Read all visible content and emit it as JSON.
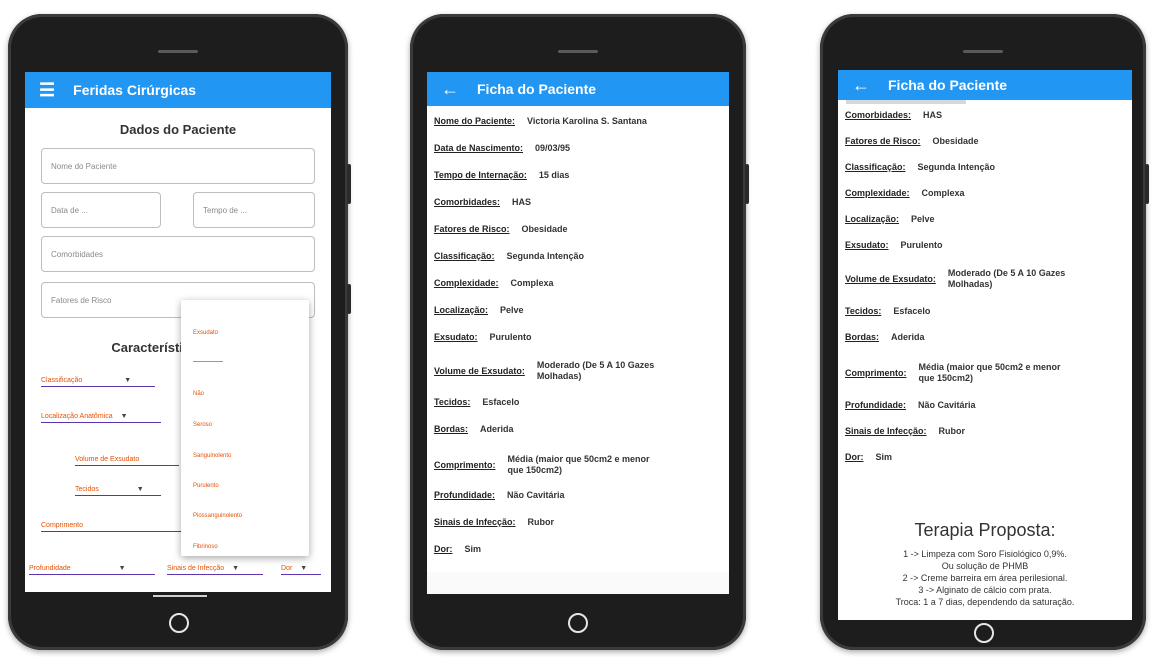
{
  "phone1": {
    "appbar": {
      "menu_icon": "hamburger-icon",
      "title": "Feridas Cirúrgicas"
    },
    "section_title": "Dados do Paciente",
    "fields": {
      "nome": "Nome do Paciente",
      "data": "Data de ...",
      "tempo": "Tempo de ...",
      "comorbidades": "Comorbidades",
      "fatores": "Fatores de Risco"
    },
    "characteristics_title": "Características",
    "selects": {
      "classificacao": "Classificação",
      "localizacao": "Localização Anatômica",
      "volume": "Volume de Exsudato",
      "tecidos": "Tecidos",
      "comprimento": "Comprimento",
      "profundidade": "Profundidade",
      "sinais": "Sinais de Infecção",
      "dor": "Dor"
    },
    "dropdown": {
      "header": "Exsudato",
      "options": [
        "Não",
        "Seroso",
        "Sanguinolento",
        "Purulento",
        "Piossanguinolento",
        "Fibrinoso"
      ]
    }
  },
  "phone2": {
    "appbar": {
      "back_icon": "arrow-left-icon",
      "title": "Ficha do Paciente"
    },
    "rows": [
      {
        "label": "Nome do Paciente:",
        "value": "Victoria Karolina S. Santana"
      },
      {
        "label": "Data de Nascimento:",
        "value": "09/03/95"
      },
      {
        "label": "Tempo de Internação:",
        "value": "15 dias"
      },
      {
        "label": "Comorbidades:",
        "value": "HAS"
      },
      {
        "label": "Fatores de Risco:",
        "value": "Obesidade"
      },
      {
        "label": "Classificação:",
        "value": "Segunda Intenção"
      },
      {
        "label": "Complexidade:",
        "value": "Complexa"
      },
      {
        "label": "Localização:",
        "value": "Pelve"
      },
      {
        "label": "Exsudato:",
        "value": "Purulento"
      },
      {
        "label": "Volume de Exsudato:",
        "value": "Moderado (De 5 A 10 Gazes Molhadas)"
      },
      {
        "label": "Tecidos:",
        "value": "Esfacelo"
      },
      {
        "label": "Bordas:",
        "value": "Aderida"
      },
      {
        "label": "Comprimento:",
        "value": "Média (maior que 50cm2 e menor que 150cm2)"
      },
      {
        "label": "Profundidade:",
        "value": "Não Cavitária"
      },
      {
        "label": "Sinais de Infecção:",
        "value": "Rubor"
      },
      {
        "label": "Dor:",
        "value": "Sim"
      }
    ]
  },
  "phone3": {
    "appbar": {
      "back_icon": "arrow-left-icon",
      "title": "Ficha do Paciente"
    },
    "rows": [
      {
        "label": "Comorbidades:",
        "value": "HAS"
      },
      {
        "label": "Fatores de Risco:",
        "value": "Obesidade"
      },
      {
        "label": "Classificação:",
        "value": "Segunda Intenção"
      },
      {
        "label": "Complexidade:",
        "value": "Complexa"
      },
      {
        "label": "Localização:",
        "value": "Pelve"
      },
      {
        "label": "Exsudato:",
        "value": "Purulento"
      },
      {
        "label": "Volume de Exsudato:",
        "value": "Moderado (De 5 A 10 Gazes Molhadas)"
      },
      {
        "label": "Tecidos:",
        "value": "Esfacelo"
      },
      {
        "label": "Bordas:",
        "value": "Aderida"
      },
      {
        "label": "Comprimento:",
        "value": "Média (maior que 50cm2 e menor que 150cm2)"
      },
      {
        "label": "Profundidade:",
        "value": "Não Cavitária"
      },
      {
        "label": "Sinais de Infecção:",
        "value": "Rubor"
      },
      {
        "label": "Dor:",
        "value": "Sim"
      }
    ],
    "terapia": {
      "title": "Terapia Proposta:",
      "lines": [
        "1 -> Limpeza com Soro Fisiológico 0,9%.",
        "Ou solução de PHMB",
        "2 -> Creme barreira em área perilesional.",
        "3 -> Alginato de cálcio com prata.",
        "Troca: 1 a 7 dias, dependendo da saturação."
      ]
    }
  },
  "colors": {
    "appbar": "#2196f3",
    "accent": "#e65100",
    "underline": "#5e35b1"
  }
}
